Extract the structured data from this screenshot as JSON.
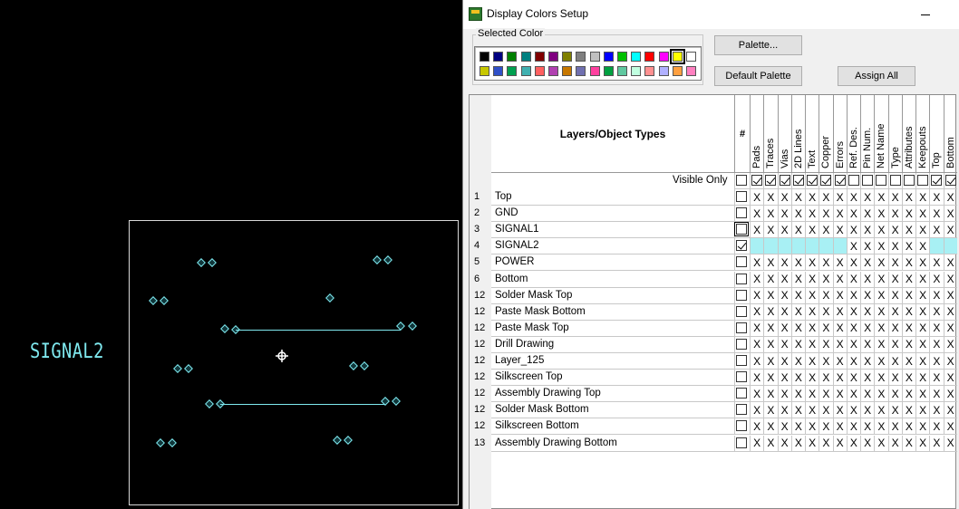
{
  "canvas": {
    "layer_label": "SIGNAL2"
  },
  "dialog": {
    "title": "Display Colors Setup",
    "selected_color_label": "Selected Color",
    "palette_button": "Palette...",
    "default_palette_button": "Default Palette",
    "assign_all_button": "Assign All",
    "selected_swatch": "yellow",
    "palette_row1": [
      "#000000",
      "#000080",
      "#008000",
      "#008080",
      "#800000",
      "#800080",
      "#808000",
      "#808080",
      "#c0c0c0",
      "#0000ff",
      "#00c000",
      "#00ffff",
      "#ff0000",
      "#ff00ff",
      "#ffff00",
      "#ffffff"
    ],
    "palette_row2": [
      "#c8c800",
      "#3050c8",
      "#00a050",
      "#40b0b0",
      "#ff6060",
      "#b040b0",
      "#c87800",
      "#7070b0",
      "#ff40a0",
      "#00a040",
      "#60c8a0",
      "#c0ffe0",
      "#ff9090",
      "#b0b0ff",
      "#ffa040",
      "#ff80c0"
    ]
  },
  "grid": {
    "header": "Layers/Object Types",
    "hash": "#",
    "columns": [
      "Pads",
      "Traces",
      "Vias",
      "2D Lines",
      "Text",
      "Copper",
      "Errors",
      "Ref. Des.",
      "Pin Num.",
      "Net Name",
      "Type",
      "Attributes",
      "Keepouts",
      "Top",
      "Bottom"
    ],
    "visible_only_label": "Visible Only",
    "visible_only_checks": [
      false,
      true,
      true,
      true,
      true,
      true,
      true,
      true,
      false,
      false,
      false,
      false,
      false,
      false,
      true,
      true
    ],
    "cell_mark": "X",
    "rows": [
      {
        "num": "1",
        "name": "Top",
        "checked": false
      },
      {
        "num": "2",
        "name": "GND",
        "checked": false
      },
      {
        "num": "3",
        "name": "SIGNAL1",
        "checked": false
      },
      {
        "num": "4",
        "name": "SIGNAL2",
        "checked": true
      },
      {
        "num": "5",
        "name": "POWER",
        "checked": false
      },
      {
        "num": "6",
        "name": "Bottom",
        "checked": false
      },
      {
        "num": "12",
        "name": "Solder Mask Top",
        "checked": false
      },
      {
        "num": "12",
        "name": "Paste Mask Bottom",
        "checked": false
      },
      {
        "num": "12",
        "name": "Paste Mask Top",
        "checked": false
      },
      {
        "num": "12",
        "name": "Drill Drawing",
        "checked": false
      },
      {
        "num": "12",
        "name": "Layer_125",
        "checked": false
      },
      {
        "num": "12",
        "name": "Silkscreen Top",
        "checked": false
      },
      {
        "num": "12",
        "name": "Assembly Drawing Top",
        "checked": false
      },
      {
        "num": "12",
        "name": "Solder Mask Bottom",
        "checked": false
      },
      {
        "num": "12",
        "name": "Silkscreen Bottom",
        "checked": false
      },
      {
        "num": "13",
        "name": "Assembly Drawing Bottom",
        "checked": false
      }
    ]
  }
}
